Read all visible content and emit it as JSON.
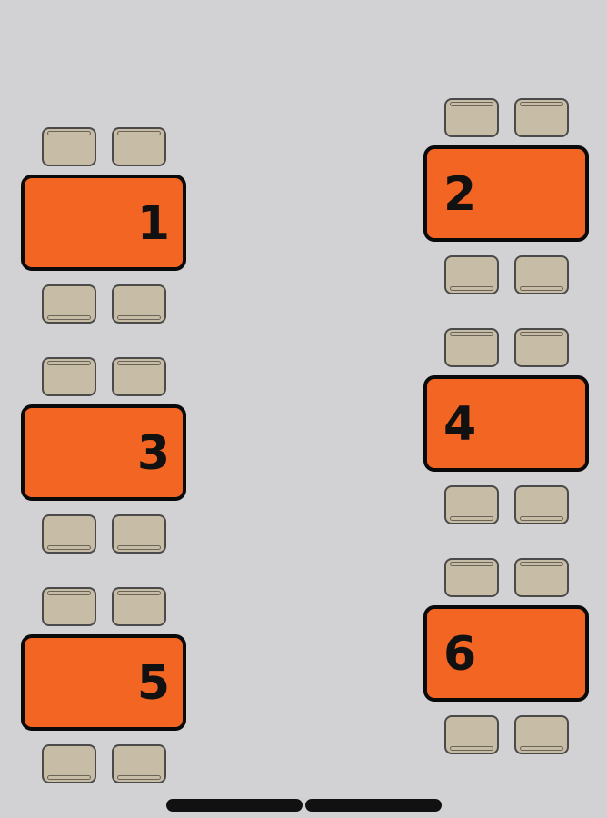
{
  "tables": [
    {
      "number": "1"
    },
    {
      "number": "2"
    },
    {
      "number": "3"
    },
    {
      "number": "4"
    },
    {
      "number": "5"
    },
    {
      "number": "6"
    }
  ],
  "colors": {
    "background": "#d2d2d4",
    "table": "#f26522",
    "table_border": "#0a0a0a",
    "chair": "#c7bca6",
    "text": "#111111"
  }
}
